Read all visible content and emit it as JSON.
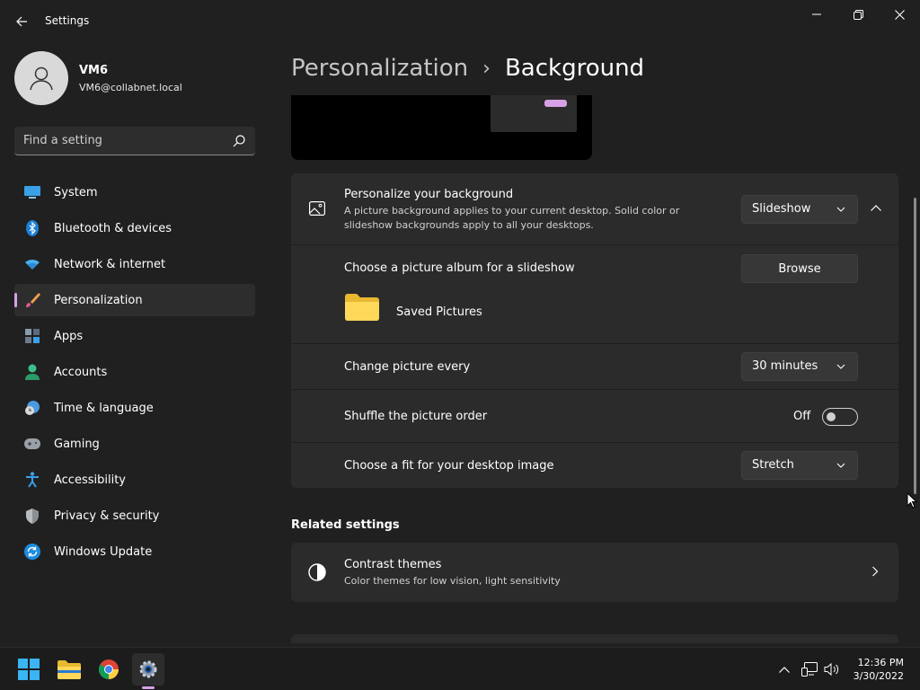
{
  "window": {
    "title": "Settings"
  },
  "profile": {
    "name": "VM6",
    "email": "VM6@collabnet.local"
  },
  "search": {
    "placeholder": "Find a setting"
  },
  "nav": {
    "items": [
      {
        "label": "System",
        "icon": "system-icon"
      },
      {
        "label": "Bluetooth & devices",
        "icon": "bluetooth-icon"
      },
      {
        "label": "Network & internet",
        "icon": "wifi-icon"
      },
      {
        "label": "Personalization",
        "icon": "brush-icon",
        "active": true
      },
      {
        "label": "Apps",
        "icon": "apps-icon"
      },
      {
        "label": "Accounts",
        "icon": "accounts-icon"
      },
      {
        "label": "Time & language",
        "icon": "clock-globe-icon"
      },
      {
        "label": "Gaming",
        "icon": "gamepad-icon"
      },
      {
        "label": "Accessibility",
        "icon": "accessibility-icon"
      },
      {
        "label": "Privacy & security",
        "icon": "shield-icon"
      },
      {
        "label": "Windows Update",
        "icon": "update-icon"
      }
    ]
  },
  "breadcrumb": {
    "parent": "Personalization",
    "separator": "›",
    "current": "Background"
  },
  "background_settings": {
    "personalize": {
      "title": "Personalize your background",
      "description": "A picture background applies to your current desktop. Solid color or slideshow backgrounds apply to all your desktops.",
      "value": "Slideshow"
    },
    "album": {
      "title": "Choose a picture album for a slideshow",
      "button": "Browse",
      "folder": "Saved Pictures"
    },
    "interval": {
      "title": "Change picture every",
      "value": "30 minutes"
    },
    "shuffle": {
      "title": "Shuffle the picture order",
      "state": "Off"
    },
    "fit": {
      "title": "Choose a fit for your desktop image",
      "value": "Stretch"
    }
  },
  "related": {
    "heading": "Related settings",
    "contrast": {
      "title": "Contrast themes",
      "description": "Color themes for low vision, light sensitivity"
    }
  },
  "taskbar": {
    "time": "12:36 PM",
    "date": "3/30/2022"
  },
  "colors": {
    "accent": "#d6a1e6",
    "background": "#202020",
    "card": "#2b2b2b"
  }
}
